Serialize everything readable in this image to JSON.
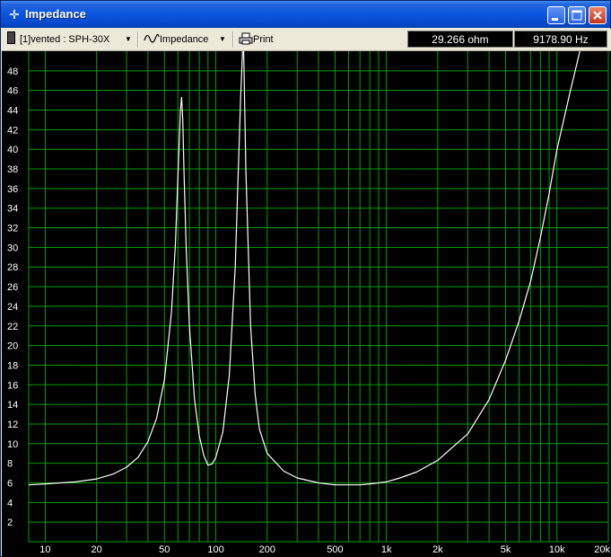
{
  "window": {
    "title": "Impedance"
  },
  "toolbar": {
    "driver_select": "[1]vented : SPH-30X",
    "view_select": "Impedance",
    "print_label": "Print"
  },
  "readouts": {
    "value": "29.266 ohm",
    "frequency": "9178.90 Hz"
  },
  "colors": {
    "background": "#000000",
    "grid": "#00A000",
    "curve": "#FFFFFF",
    "text": "#FFFFFF"
  },
  "chart_data": {
    "type": "line",
    "title": "",
    "xlabel": "",
    "ylabel": "",
    "x_scale": "log",
    "xlim": [
      8,
      20000
    ],
    "ylim": [
      0,
      50
    ],
    "grid": true,
    "x_ticks": [
      {
        "value": 10,
        "label": "10"
      },
      {
        "value": 20,
        "label": "20"
      },
      {
        "value": 50,
        "label": "50"
      },
      {
        "value": 100,
        "label": "100"
      },
      {
        "value": 200,
        "label": "200"
      },
      {
        "value": 500,
        "label": "500"
      },
      {
        "value": 1000,
        "label": "1k"
      },
      {
        "value": 2000,
        "label": "2k"
      },
      {
        "value": 5000,
        "label": "5k"
      },
      {
        "value": 10000,
        "label": "10k"
      },
      {
        "value": 20000,
        "label": "20k"
      }
    ],
    "y_ticks": [
      2,
      4,
      6,
      8,
      10,
      12,
      14,
      16,
      18,
      20,
      22,
      24,
      26,
      28,
      30,
      32,
      34,
      36,
      38,
      40,
      42,
      44,
      46,
      48
    ],
    "series": [
      {
        "x": [
          8,
          10,
          15,
          20,
          25,
          30,
          35,
          40,
          45,
          50,
          55,
          58,
          60,
          62,
          63,
          64,
          65,
          67,
          70,
          75,
          80,
          85,
          90,
          95,
          100,
          110,
          120,
          130,
          135,
          140,
          145,
          150,
          160,
          170,
          180,
          200,
          250,
          300,
          400,
          500,
          600,
          700,
          800,
          1000,
          1200,
          1500,
          2000,
          3000,
          4000,
          5000,
          6000,
          7000,
          8000,
          9000,
          10000,
          12000,
          15000,
          18000,
          20000
        ],
        "y": [
          5.8,
          5.9,
          6.1,
          6.4,
          6.9,
          7.6,
          8.6,
          10.2,
          12.6,
          16.5,
          23.5,
          30.5,
          37.5,
          44,
          45.3,
          43,
          38,
          30,
          22,
          14.5,
          10.8,
          8.8,
          7.8,
          7.9,
          8.6,
          11.2,
          17,
          28,
          37,
          45.5,
          52,
          38,
          22,
          15,
          11.5,
          9,
          7.2,
          6.5,
          6,
          5.8,
          5.8,
          5.8,
          5.9,
          6.1,
          6.5,
          7.1,
          8.3,
          11,
          14.5,
          18.5,
          22.5,
          26.5,
          31,
          35.5,
          40,
          46,
          53,
          58,
          62
        ]
      }
    ]
  }
}
